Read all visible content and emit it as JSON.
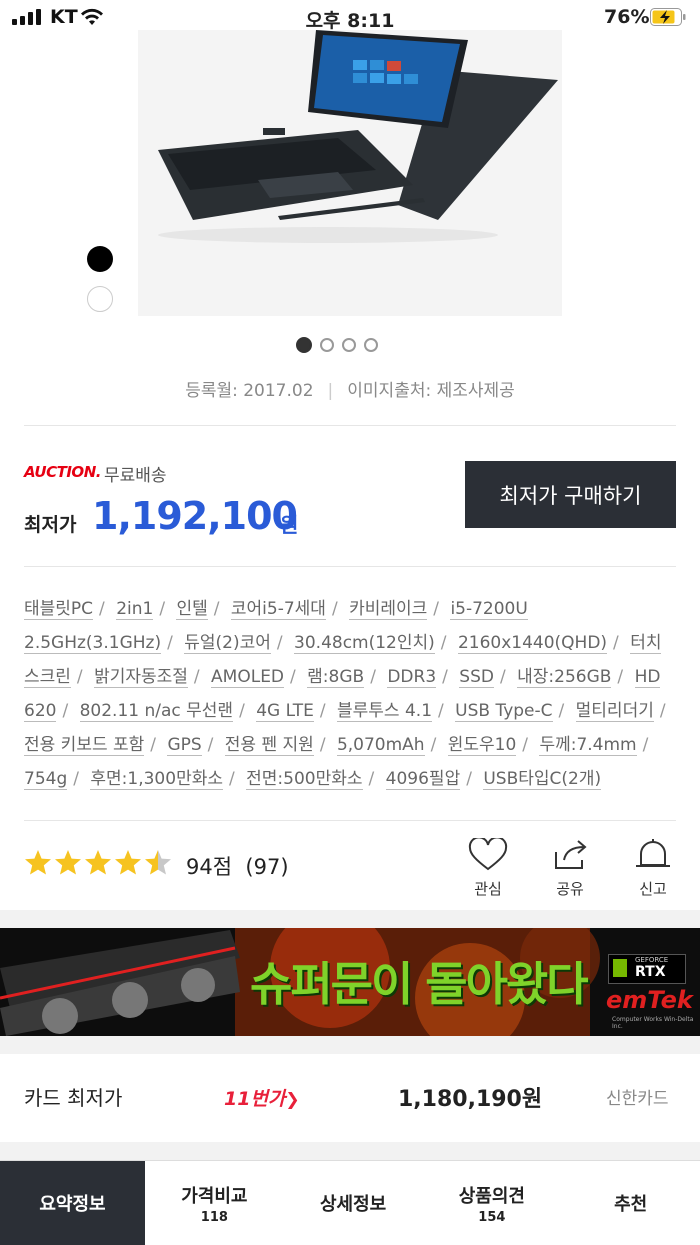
{
  "status_bar": {
    "carrier": "KT",
    "time": "오후 8:11",
    "battery": "76%"
  },
  "gallery": {
    "colors": [
      "black",
      "white"
    ],
    "page_count": 4,
    "active_page": 1
  },
  "meta": {
    "registered": "등록월: 2017.02",
    "image_source": "이미지출처: 제조사제공"
  },
  "price_block": {
    "seller_logo": "AUCTION.",
    "shipping": "무료배송",
    "lowest_label": "최저가",
    "price": "1,192,100",
    "currency": "원",
    "buy_button": "최저가 구매하기",
    "colors": {
      "price": "#2a5bd7",
      "button_bg": "#2b2f36",
      "auction": "#e60012"
    }
  },
  "specs": [
    "태블릿PC",
    "2in1",
    "인텔",
    "코어i5-7세대",
    "카비레이크",
    "i5-7200U 2.5GHz(3.1GHz)",
    "듀얼(2)코어",
    "30.48cm(12인치)",
    "2160x1440(QHD)",
    "터치스크린",
    "밝기자동조절",
    "AMOLED",
    "램:8GB",
    "DDR3",
    "SSD",
    "내장:256GB",
    "HD 620",
    "802.11 n/ac 무선랜",
    "4G LTE",
    "블루투스 4.1",
    "USB Type-C",
    "멀티리더기",
    "전용 키보드 포함",
    "GPS",
    "전용 펜 지원",
    "5,070mAh",
    "윈도우10",
    "두께:7.4mm",
    "754g",
    "후면:1,300만화소",
    "전면:500만화소",
    "4096필압",
    "USB타입C(2개)"
  ],
  "rating": {
    "stars": 4.5,
    "max_stars": 5,
    "score": "94점",
    "count": "(97)"
  },
  "actions": {
    "like": "관심",
    "share": "공유",
    "report": "신고"
  },
  "banner": {
    "headline": "슈퍼문이 돌아왔다",
    "badge": "RTX",
    "badge_top": "GEFORCE",
    "brand": "emTek",
    "brand_sub": "Computer Works Win-Delta Inc."
  },
  "card_row": {
    "label": "카드 최저가",
    "mall_logo": "11번가",
    "price": "1,180,190원",
    "card": "신한카드"
  },
  "tabs": [
    {
      "label": "요약정보",
      "count": ""
    },
    {
      "label": "가격비교",
      "count": "118"
    },
    {
      "label": "상세정보",
      "count": ""
    },
    {
      "label": "상품의견",
      "count": "154"
    },
    {
      "label": "추천",
      "count": ""
    }
  ]
}
